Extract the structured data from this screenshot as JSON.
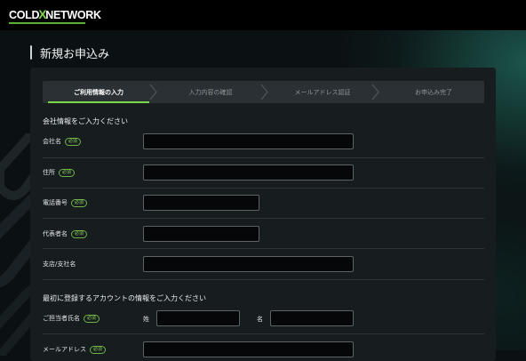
{
  "app": {
    "logo": {
      "left": "COLD",
      "x": "X",
      "right": "NETWORK"
    },
    "page_title": "新規お申込み"
  },
  "steps": [
    {
      "label": "ご利用情報の入力",
      "active": true
    },
    {
      "label": "入力内容の確認",
      "active": false
    },
    {
      "label": "メールアドレス認証",
      "active": false
    },
    {
      "label": "お申込み完了",
      "active": false
    }
  ],
  "company_section": {
    "heading": "会社情報をご入力ください",
    "required_label": "必須",
    "fields": [
      {
        "label": "会社名",
        "value": "",
        "required": true
      },
      {
        "label": "住所",
        "value": "",
        "required": true
      },
      {
        "label": "電話番号",
        "value": "",
        "required": true
      },
      {
        "label": "代表者名",
        "value": "",
        "required": true
      },
      {
        "label": "支店/支社名",
        "value": "",
        "required": false
      }
    ]
  },
  "account_section": {
    "heading": "最初に登録するアカウントの情報をご入力ください",
    "name_field": {
      "label": "ご担当者氏名",
      "required": true,
      "last_name_label": "姓",
      "first_name_label": "名",
      "last_name_value": "",
      "first_name_value": ""
    },
    "email_field": {
      "label": "メールアドレス",
      "required": true,
      "value": ""
    }
  },
  "colors": {
    "accent": "#7bd64a",
    "panel": "#171c1f",
    "input_bg": "#050708",
    "steps_bg": "#2a3033"
  }
}
